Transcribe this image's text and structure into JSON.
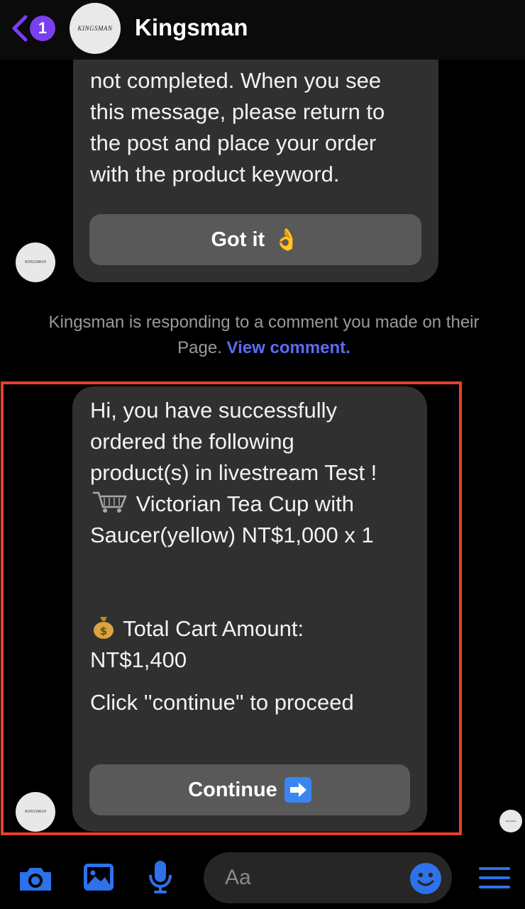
{
  "header": {
    "title": "Kingsman",
    "unread_count": "1",
    "avatar_text": "KINGSMAN"
  },
  "messages": {
    "first": {
      "lines": [
        "not completed. When you see",
        "this message, please return to",
        "the post and place your order",
        "with the product keyword."
      ],
      "button_label": "Got it",
      "button_emoji": "👌"
    },
    "notice": {
      "text": "Kingsman is responding to a comment you made on their Page.",
      "link": "View comment."
    },
    "second": {
      "line1": "Hi, you have successfully",
      "line2": "ordered the following",
      "line3": "product(s) in livestream Test !",
      "line4": "Victorian Tea Cup with",
      "line5": "Saucer(yellow) NT$1,000 x 1",
      "line6": "Total Cart Amount:",
      "line7": "NT$1,400",
      "line8": "Click ''continue'' to proceed",
      "button_label": "Continue"
    }
  },
  "composer": {
    "placeholder": "Aa"
  },
  "icons": {
    "camera": "camera-icon",
    "gallery": "image-icon",
    "mic": "microphone-icon",
    "emoji": "smiley-icon",
    "menu": "menu-icon"
  },
  "colors": {
    "accent": "#7b3ff2",
    "link": "#5b6cf5",
    "icon_blue": "#2d72ea",
    "highlight": "#e8402a"
  }
}
